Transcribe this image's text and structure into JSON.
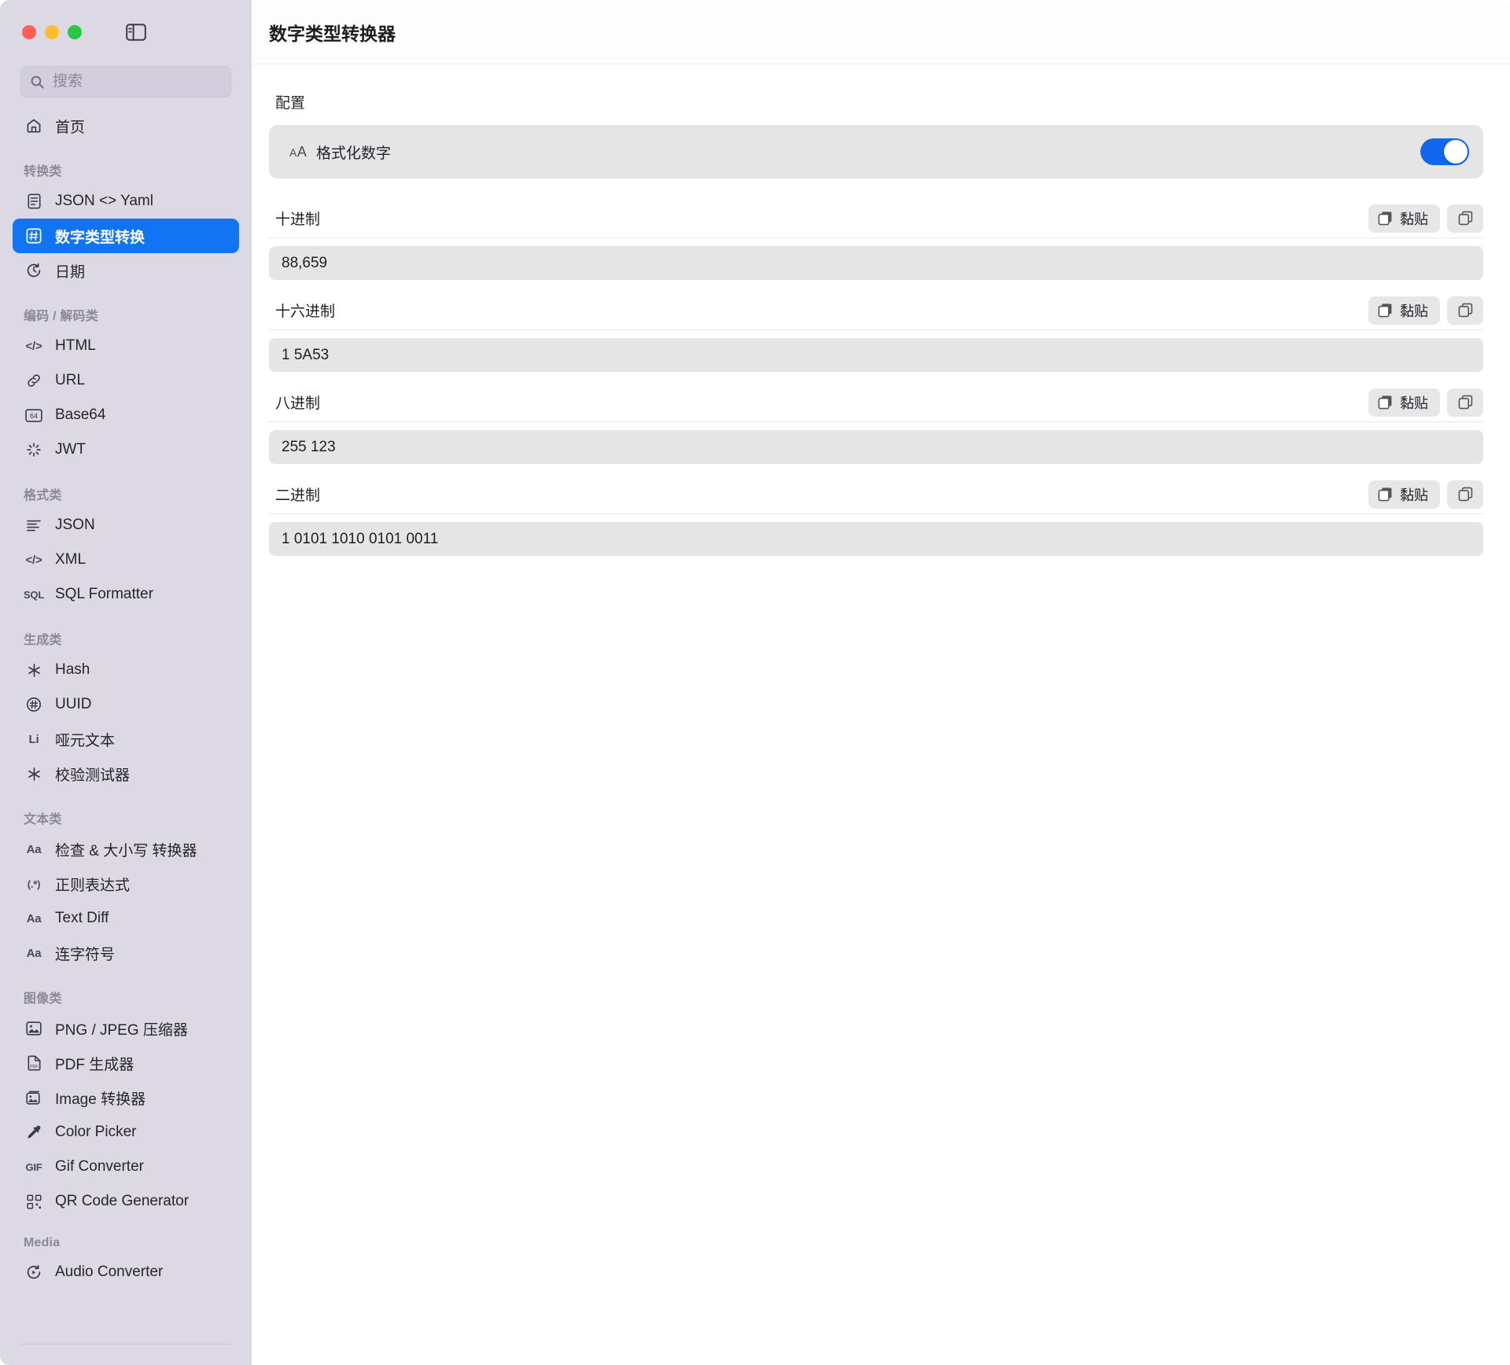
{
  "window": {
    "traffic_lights": [
      "close",
      "minimize",
      "zoom"
    ],
    "sidebar_toggle_icon": "sidebar-toggle-icon",
    "colors": {
      "sidebar_bg": "#dcd8e4",
      "accent": "#1174f2",
      "toggle_on": "#1168ef",
      "field_bg": "#e5e5e6",
      "button_bg": "#e7e7e8"
    }
  },
  "search": {
    "placeholder": "搜索",
    "value": "",
    "icon": "search-icon"
  },
  "sidebar": {
    "home": {
      "label": "首页",
      "icon": "home-icon"
    },
    "sections": [
      {
        "title": "转换类",
        "items": [
          {
            "label": "JSON <> Yaml",
            "icon": "document-icon",
            "glyph": "",
            "active": false
          },
          {
            "label": "数字类型转换",
            "icon": "hash-box-icon",
            "glyph": "",
            "active": true
          },
          {
            "label": "日期",
            "icon": "clock-rotate-icon",
            "glyph": "",
            "active": false
          }
        ]
      },
      {
        "title": "编码 / 解码类",
        "items": [
          {
            "label": "HTML",
            "icon": "code-brackets-icon",
            "glyph": "</>",
            "active": false
          },
          {
            "label": "URL",
            "icon": "link-icon",
            "glyph": "",
            "active": false
          },
          {
            "label": "Base64",
            "icon": "base64-box-icon",
            "glyph": "64",
            "active": false
          },
          {
            "label": "JWT",
            "icon": "spinner-icon",
            "glyph": "",
            "active": false
          }
        ]
      },
      {
        "title": "格式类",
        "items": [
          {
            "label": "JSON",
            "icon": "text-lines-icon",
            "glyph": "",
            "active": false
          },
          {
            "label": "XML",
            "icon": "code-brackets-icon",
            "glyph": "</>",
            "active": false
          },
          {
            "label": "SQL Formatter",
            "icon": "sql-text-icon",
            "glyph": "SQL",
            "active": false
          }
        ]
      },
      {
        "title": "生成类",
        "items": [
          {
            "label": "Hash",
            "icon": "asterisk-icon",
            "glyph": "",
            "active": false
          },
          {
            "label": "UUID",
            "icon": "circled-hash-icon",
            "glyph": "",
            "active": false
          },
          {
            "label": "哑元文本",
            "icon": "lorem-text-icon",
            "glyph": "Li",
            "active": false
          },
          {
            "label": "校验测试器",
            "icon": "asterisk-icon",
            "glyph": "",
            "active": false
          }
        ]
      },
      {
        "title": "文本类",
        "items": [
          {
            "label": "检查 & 大小写 转换器",
            "icon": "aa-text-icon",
            "glyph": "Aa",
            "active": false
          },
          {
            "label": "正则表达式",
            "icon": "regex-text-icon",
            "glyph": "(.*)",
            "active": false
          },
          {
            "label": "Text Diff",
            "icon": "aa-text-icon",
            "glyph": "Aa",
            "active": false
          },
          {
            "label": "连字符号",
            "icon": "aa-text-icon",
            "glyph": "Aa",
            "active": false
          }
        ]
      },
      {
        "title": "图像类",
        "items": [
          {
            "label": "PNG / JPEG 压缩器",
            "icon": "image-icon",
            "glyph": "",
            "active": false
          },
          {
            "label": "PDF 生成器",
            "icon": "pdf-file-icon",
            "glyph": "",
            "active": false
          },
          {
            "label": "Image 转换器",
            "icon": "image-convert-icon",
            "glyph": "",
            "active": false
          },
          {
            "label": "Color Picker",
            "icon": "eyedropper-icon",
            "glyph": "",
            "active": false
          },
          {
            "label": "Gif Converter",
            "icon": "gif-text-icon",
            "glyph": "GIF",
            "active": false
          },
          {
            "label": "QR Code Generator",
            "icon": "qr-code-icon",
            "glyph": "",
            "active": false
          }
        ]
      },
      {
        "title": "Media",
        "items": [
          {
            "label": "Audio Converter",
            "icon": "audio-rotate-icon",
            "glyph": "",
            "active": false
          }
        ]
      }
    ]
  },
  "main": {
    "title": "数字类型转换器",
    "config_section_label": "配置",
    "config": {
      "icon": "aa-format-icon",
      "icon_glyph": "AA",
      "label": "格式化数字",
      "toggle_on": true
    },
    "paste_label": "黏贴",
    "paste_icon": "paste-icon",
    "copy_icon": "copy-icon",
    "conversions": [
      {
        "label": "十进制",
        "value": "88,659"
      },
      {
        "label": "十六进制",
        "value": "1 5A53"
      },
      {
        "label": "八进制",
        "value": "255 123"
      },
      {
        "label": "二进制",
        "value": "1 0101 1010 0101 0011"
      }
    ]
  }
}
